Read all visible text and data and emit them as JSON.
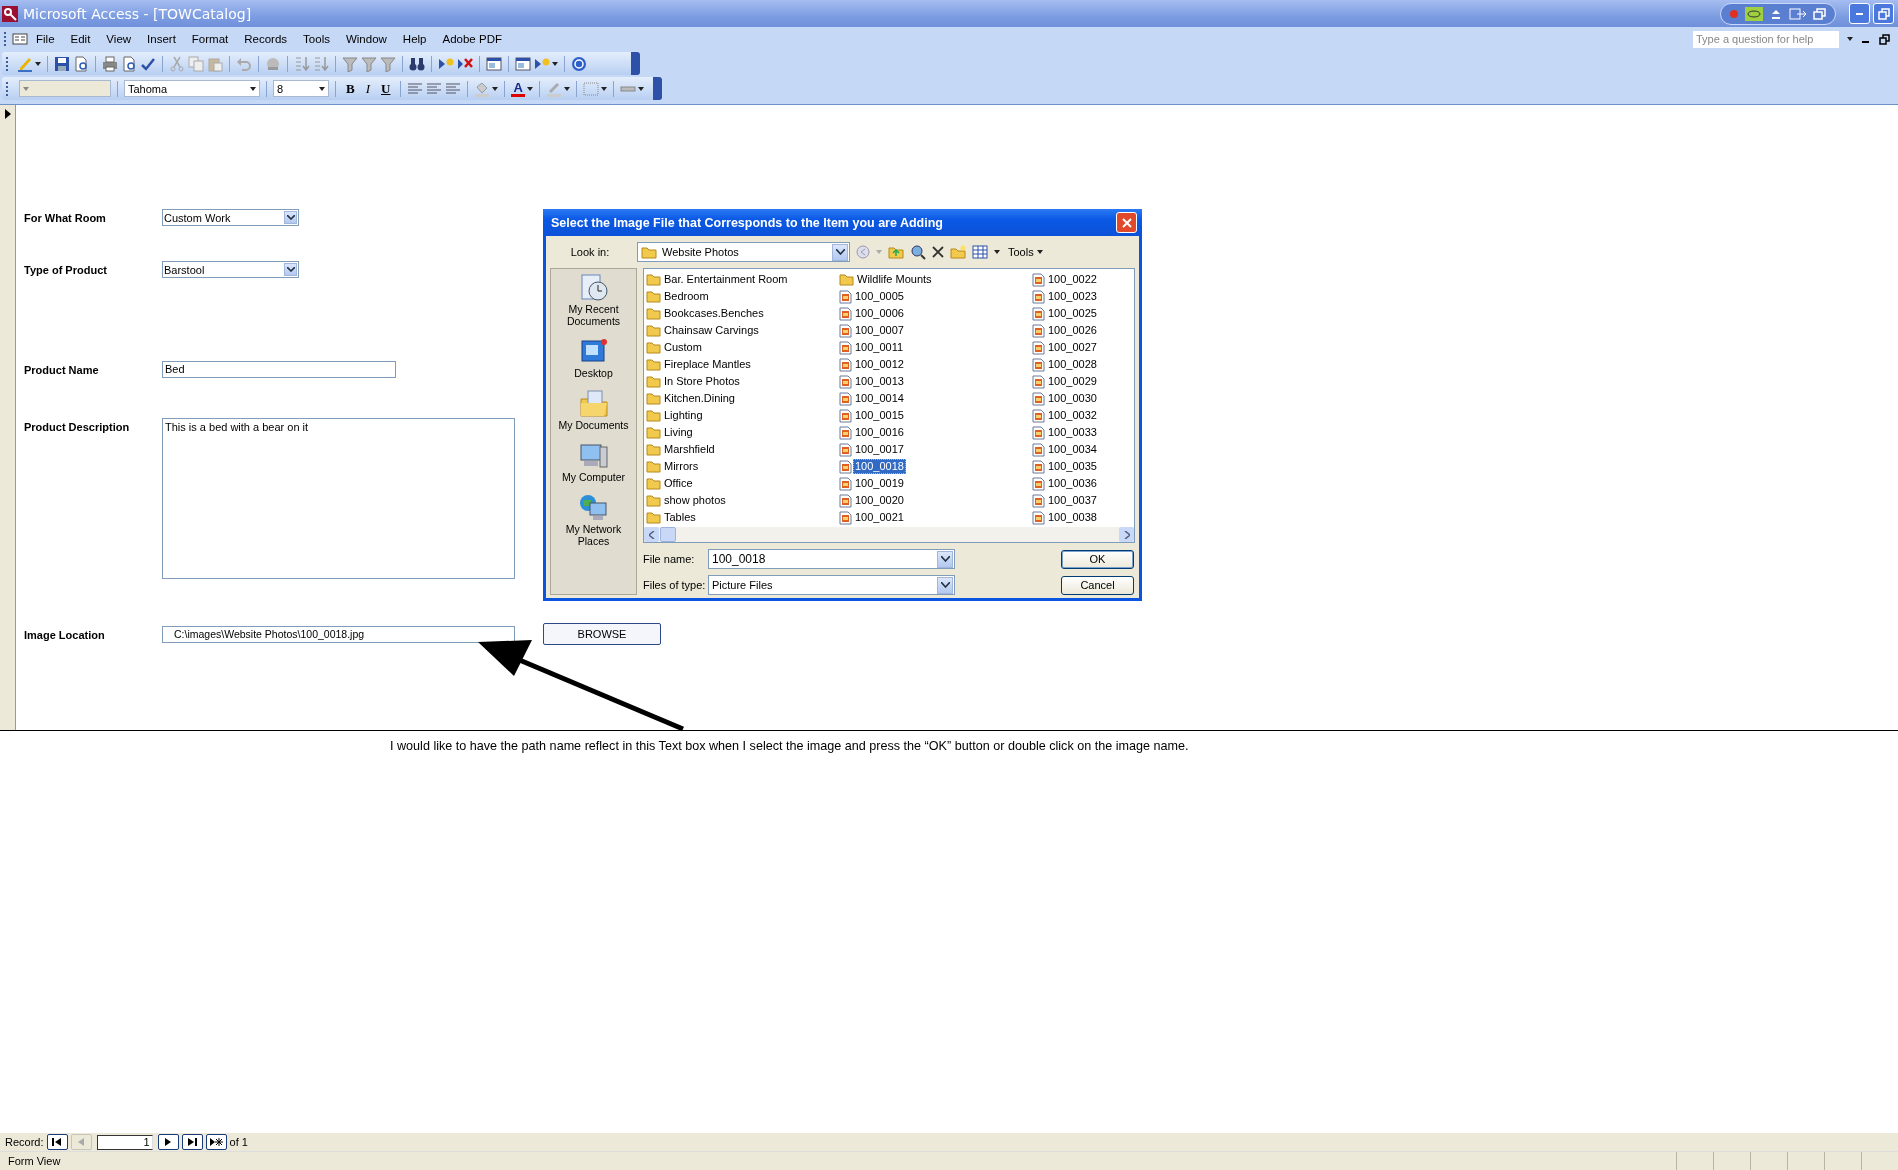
{
  "window": {
    "title": "Microsoft Access - [TOWCatalog]"
  },
  "menu_bar": [
    "File",
    "Edit",
    "View",
    "Insert",
    "Format",
    "Records",
    "Tools",
    "Window",
    "Help",
    "Adobe PDF"
  ],
  "help_box": {
    "placeholder": "Type a question for help"
  },
  "formatting_toolbar": {
    "font": "Tahoma",
    "font_size": "8",
    "style_buttons": [
      "B",
      "I",
      "U"
    ],
    "font_color_glyph": "A"
  },
  "form": {
    "fields": [
      {
        "label": "For What Room",
        "kind": "combo",
        "value": "Custom Work"
      },
      {
        "label": "Type of Product",
        "kind": "combo",
        "value": "Barstool"
      },
      {
        "label": "Product Name",
        "kind": "text",
        "value": "Bed"
      },
      {
        "label": "Product Description",
        "kind": "memo",
        "value": "This is a bed with a bear on it"
      },
      {
        "label": "Image Location",
        "kind": "path",
        "value": "C:\\images\\Website Photos\\100_0018.jpg"
      }
    ],
    "browse_button": "BROWSE"
  },
  "dialog": {
    "title": "Select the Image File that Corresponds to the Item you are Adding",
    "look_in_label": "Look in:",
    "look_in_value": "Website Photos",
    "tools_menu": "Tools",
    "places": [
      {
        "label": "My Recent Documents",
        "kind": "recent"
      },
      {
        "label": "Desktop",
        "kind": "desktop"
      },
      {
        "label": "My Documents",
        "kind": "documents"
      },
      {
        "label": "My Computer",
        "kind": "computer"
      },
      {
        "label": "My Network Places",
        "kind": "network"
      }
    ],
    "files": [
      {
        "name": "Bar. Entertainment Room",
        "kind": "folder",
        "selected": false
      },
      {
        "name": "Bedroom",
        "kind": "folder",
        "selected": false
      },
      {
        "name": "Bookcases.Benches",
        "kind": "folder",
        "selected": false
      },
      {
        "name": "Chainsaw Carvings",
        "kind": "folder",
        "selected": false
      },
      {
        "name": "Custom",
        "kind": "folder",
        "selected": false
      },
      {
        "name": "Fireplace Mantles",
        "kind": "folder",
        "selected": false
      },
      {
        "name": "In Store Photos",
        "kind": "folder",
        "selected": false
      },
      {
        "name": "Kitchen.Dining",
        "kind": "folder",
        "selected": false
      },
      {
        "name": "Lighting",
        "kind": "folder",
        "selected": false
      },
      {
        "name": "Living",
        "kind": "folder",
        "selected": false
      },
      {
        "name": "Marshfield",
        "kind": "folder",
        "selected": false
      },
      {
        "name": "Mirrors",
        "kind": "folder",
        "selected": false
      },
      {
        "name": "Office",
        "kind": "folder",
        "selected": false
      },
      {
        "name": "show photos",
        "kind": "folder",
        "selected": false
      },
      {
        "name": "Tables",
        "kind": "folder",
        "selected": false
      },
      {
        "name": "Wildlife Mounts",
        "kind": "folder",
        "selected": false
      },
      {
        "name": "100_0005",
        "kind": "image",
        "selected": false
      },
      {
        "name": "100_0006",
        "kind": "image",
        "selected": false
      },
      {
        "name": "100_0007",
        "kind": "image",
        "selected": false
      },
      {
        "name": "100_0011",
        "kind": "image",
        "selected": false
      },
      {
        "name": "100_0012",
        "kind": "image",
        "selected": false
      },
      {
        "name": "100_0013",
        "kind": "image",
        "selected": false
      },
      {
        "name": "100_0014",
        "kind": "image",
        "selected": false
      },
      {
        "name": "100_0015",
        "kind": "image",
        "selected": false
      },
      {
        "name": "100_0016",
        "kind": "image",
        "selected": false
      },
      {
        "name": "100_0017",
        "kind": "image",
        "selected": false
      },
      {
        "name": "100_0018",
        "kind": "image",
        "selected": true
      },
      {
        "name": "100_0019",
        "kind": "image",
        "selected": false
      },
      {
        "name": "100_0020",
        "kind": "image",
        "selected": false
      },
      {
        "name": "100_0021",
        "kind": "image",
        "selected": false
      },
      {
        "name": "100_0022",
        "kind": "image",
        "selected": false
      },
      {
        "name": "100_0023",
        "kind": "image",
        "selected": false
      },
      {
        "name": "100_0025",
        "kind": "image",
        "selected": false
      },
      {
        "name": "100_0026",
        "kind": "image",
        "selected": false
      },
      {
        "name": "100_0027",
        "kind": "image",
        "selected": false
      },
      {
        "name": "100_0028",
        "kind": "image",
        "selected": false
      },
      {
        "name": "100_0029",
        "kind": "image",
        "selected": false
      },
      {
        "name": "100_0030",
        "kind": "image",
        "selected": false
      },
      {
        "name": "100_0032",
        "kind": "image",
        "selected": false
      },
      {
        "name": "100_0033",
        "kind": "image",
        "selected": false
      },
      {
        "name": "100_0034",
        "kind": "image",
        "selected": false
      },
      {
        "name": "100_0035",
        "kind": "image",
        "selected": false
      },
      {
        "name": "100_0036",
        "kind": "image",
        "selected": false
      },
      {
        "name": "100_0037",
        "kind": "image",
        "selected": false
      },
      {
        "name": "100_0038",
        "kind": "image",
        "selected": false
      }
    ],
    "file_name_label": "File name:",
    "file_name_value": "100_0018",
    "file_type_label": "Files of type:",
    "file_type_value": "Picture Files",
    "ok_button": "OK",
    "cancel_button": "Cancel"
  },
  "annotation": "I would like to have the path name reflect in this Text box when I select the image and press the “OK” button or double click on the image name.",
  "record_navigator": {
    "label": "Record:",
    "current": "1",
    "total": "of 1",
    "buttons": [
      {
        "kind": "first",
        "disabled": false
      },
      {
        "kind": "previous",
        "disabled": true
      }
    ],
    "buttons_after": [
      {
        "kind": "next",
        "disabled": false
      },
      {
        "kind": "last",
        "disabled": false
      },
      {
        "kind": "new",
        "disabled": false
      }
    ]
  },
  "status_bar": "Form View"
}
